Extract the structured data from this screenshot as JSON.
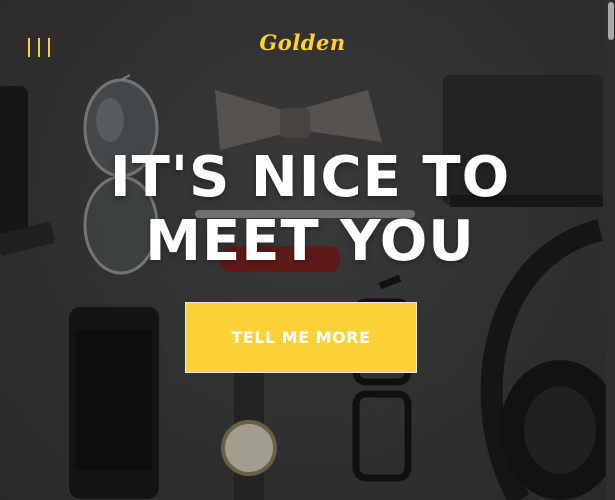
{
  "nav": {
    "menu_icon": "hamburger-menu-icon",
    "brand": "Golden"
  },
  "hero": {
    "heading_line1": "IT'S NICE TO",
    "heading_line2": "MEET YOU",
    "cta_label": "TELL ME MORE",
    "background_image": "desk-flat-lay-photo"
  },
  "colors": {
    "accent": "#fed136",
    "heading": "#ffffff",
    "background": "#3b3b3b"
  }
}
